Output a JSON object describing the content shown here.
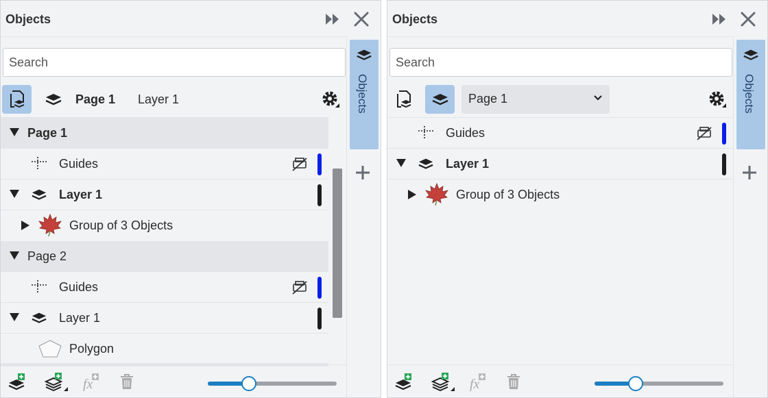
{
  "left": {
    "title": "Objects",
    "search_placeholder": "Search",
    "toolbar": {
      "page_label": "Page 1",
      "layer_label": "Layer 1"
    },
    "rows": {
      "page1": "Page 1",
      "guides1": "Guides",
      "layer1": "Layer 1",
      "group1": "Group of 3 Objects",
      "page2": "Page 2",
      "guides2": "Guides",
      "layer2": "Layer 1",
      "polygon": "Polygon"
    },
    "tab_label": "Objects",
    "zoom_level": 0.32
  },
  "right": {
    "title": "Objects",
    "search_placeholder": "Search",
    "toolbar": {
      "page_select": "Page 1"
    },
    "rows": {
      "guides": "Guides",
      "layer1": "Layer 1",
      "group1": "Group of 3 Objects"
    },
    "tab_label": "Objects",
    "zoom_level": 0.32
  },
  "colors": {
    "guides_color": "#0a1fe8",
    "layer_color": "#1e1e1e",
    "active_button": "#a9c8e8",
    "slider_accent": "#1b7fc2",
    "leaf_red": "#c4403a",
    "add_green": "#2aa65a"
  }
}
